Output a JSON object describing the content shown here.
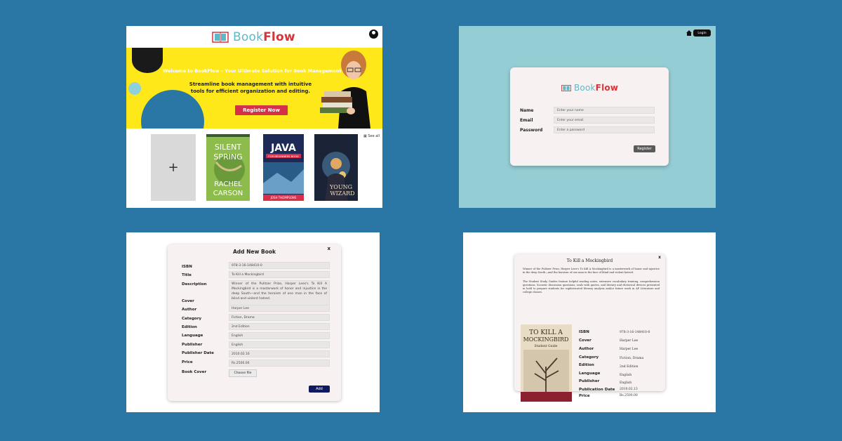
{
  "colors": {
    "background": "#2a77a6",
    "brand_teal": "#5fb8c8",
    "brand_red": "#d9333a",
    "banner_yellow": "#ffe81a",
    "register_pink": "#d62f4a",
    "register_bg": "#95cdd4",
    "add_button": "#111a5e"
  },
  "landing": {
    "brand": {
      "part1": "Book",
      "part2": "Flow"
    },
    "account_icon": "user-circle-icon",
    "banner": {
      "welcome": "Welcome to BookFlow – Your Ultimate Solution for Book Management",
      "tagline": "Streamline book management with intuitive tools for efficient organization and editing.",
      "register_label": "Register Now"
    },
    "shelf": {
      "add_icon": "+",
      "see_all": "See all",
      "books": [
        {
          "title_top": "SILENT",
          "title_mid": "SPRING",
          "author_top": "RACHEL",
          "author_bottom": "CARSON"
        },
        {
          "title": "JAVA",
          "subtitle": "FOR BEGINNERS BOOK",
          "author": "JOSH THOMPSONS"
        },
        {
          "title_top": "YOUNG",
          "title_bottom": "WIZARD"
        }
      ]
    }
  },
  "register": {
    "home_icon": "home-icon",
    "login_label": "Login",
    "brand": {
      "part1": "Book",
      "part2": "Flow"
    },
    "fields": [
      {
        "label": "Name",
        "placeholder": "Enter your name"
      },
      {
        "label": "Email",
        "placeholder": "Enter your email"
      },
      {
        "label": "Password",
        "placeholder": "Enter a password"
      }
    ],
    "submit_label": "Register"
  },
  "add_book": {
    "title": "Add New Book",
    "close": "x",
    "fields": [
      {
        "label": "ISBN",
        "value": "978-3-16-148410-0"
      },
      {
        "label": "Title",
        "value": "To Kill a Mockingbird"
      },
      {
        "label": "Description",
        "value": "Winner of the Pulitzer Prize, Harper Lees's To Kill A Mockingbird is a masterwork of honor and injustice in the deep South—and the heroism of one man in the face of blind and violent hatred."
      },
      {
        "label": "Cover",
        "value": ""
      },
      {
        "label": "Author",
        "value": "Harper Lee"
      },
      {
        "label": "Category",
        "value": "Fiction, Drama"
      },
      {
        "label": "Edition",
        "value": "2nd Edition"
      },
      {
        "label": "Language",
        "value": "English"
      },
      {
        "label": "Publisher",
        "value": "English"
      },
      {
        "label": "Publisher Date",
        "value": "2010.02.16"
      },
      {
        "label": "Price",
        "value": "Rs.2500.00"
      }
    ],
    "book_cover_label": "Book Cover",
    "choose_file": "Choose file",
    "add_label": "Add"
  },
  "book_details": {
    "title": "To Kill a Mockingbird",
    "close": "x",
    "description_1": "Winner of the Pulitzer Prize, Harper Lees's To Kill A Mockingbird is a masterwork of honor and injustice in the deep South—and the heroism of one man in the face of blind and violent hatred.",
    "description_2": "The Student Study Guides feature helpful reading notes, extensive vocabulary training, comprehension questions, Socratic discussion questions, seals with quotes, and literary and rhetorical devices presented in bold to prepare students for sophisticated literary analysis and/or future work in AP Literature and college classes.",
    "cover": {
      "line1": "TO KILL A",
      "line2": "MOCKINGBIRD",
      "line3": "Student Guide"
    },
    "fields": [
      {
        "label": "ISBN",
        "value": "978-3-16-148410-0"
      },
      {
        "label": "Cover",
        "value": "Harper Lee"
      },
      {
        "label": "Author",
        "value": "Harper Lee"
      },
      {
        "label": "Category",
        "value": "Fiction, Drama"
      },
      {
        "label": "Edition",
        "value": "2nd Edition"
      },
      {
        "label": "Language",
        "value": "English"
      },
      {
        "label": "Publisher",
        "value": "English"
      },
      {
        "label": "Publication Date",
        "value": "2010.02.13"
      },
      {
        "label": "Price",
        "value": "Rs.2500.00"
      }
    ]
  }
}
